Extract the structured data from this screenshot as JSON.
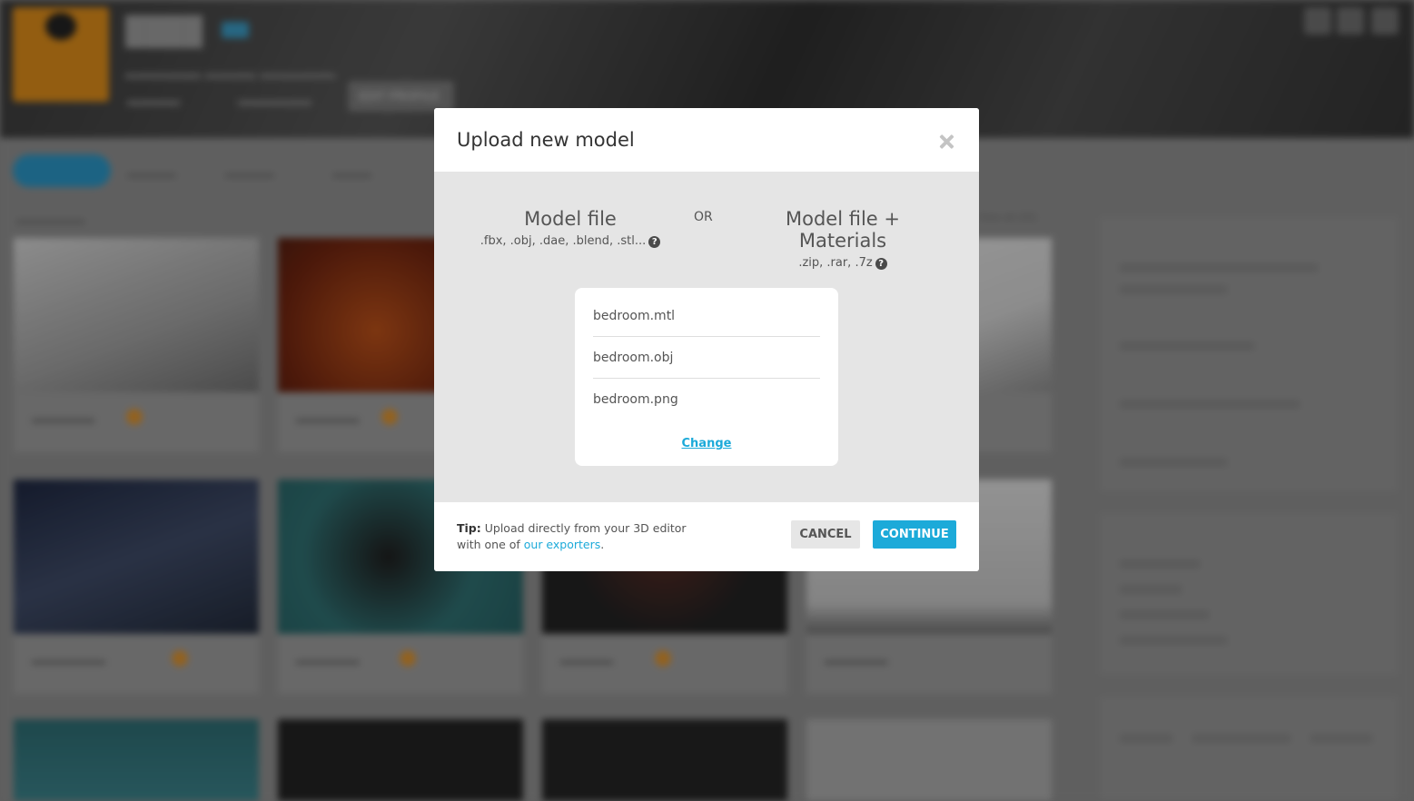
{
  "background": {
    "edit_profile_label": "EDIT PROFILE",
    "view_all_label": "View all (32)",
    "accent_color": "#1caad9"
  },
  "modal": {
    "title": "Upload new model",
    "close_icon": "close-icon",
    "option_single": {
      "title": "Model file",
      "extensions": ".fbx, .obj, .dae, .blend, .stl...",
      "help_icon": "question-circle-icon"
    },
    "or_label": "OR",
    "option_archive": {
      "title": "Model file + Materials",
      "extensions": ".zip, .rar, .7z",
      "help_icon": "question-circle-icon"
    },
    "files": [
      "bedroom.mtl",
      "bedroom.obj",
      "bedroom.png"
    ],
    "change_label": "Change",
    "tip": {
      "label": "Tip:",
      "text_before": " Upload directly from your 3D editor with one of ",
      "link_text": "our exporters",
      "text_after": "."
    },
    "cancel_label": "CANCEL",
    "continue_label": "CONTINUE"
  }
}
